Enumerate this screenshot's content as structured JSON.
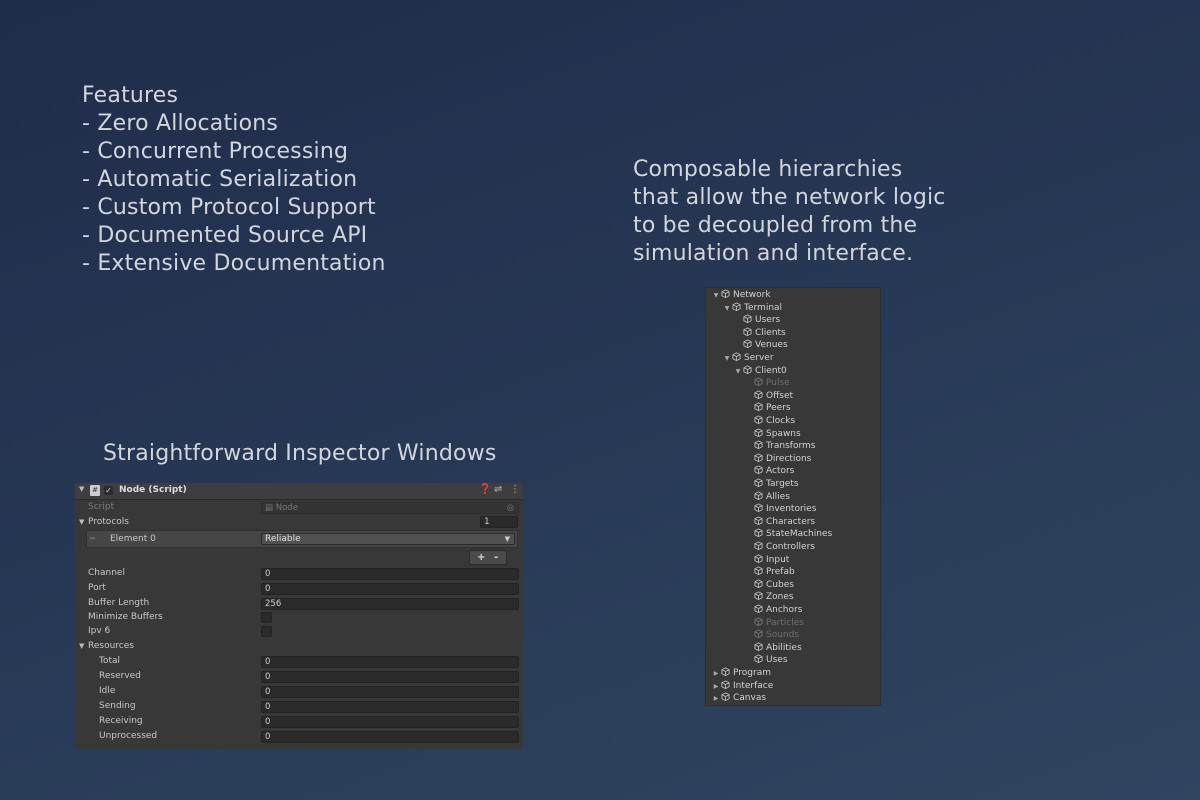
{
  "features": {
    "lines": [
      "Features",
      "- Zero Allocations",
      "- Concurrent Processing",
      "- Automatic Serialization",
      "- Custom Protocol Support",
      "- Documented Source API",
      "- Extensive Documentation"
    ]
  },
  "composable": {
    "lines": [
      "Composable hierarchies",
      "that allow the network logic",
      "to be decoupled from the",
      "simulation and interface."
    ]
  },
  "inspector_title": "Straightforward Inspector Windows",
  "inspector": {
    "header_title": "Node (Script)",
    "script_label": "Script",
    "script_value": "Node",
    "protocols_label": "Protocols",
    "protocols_count": "1",
    "element_label": "Element 0",
    "element_value": "Reliable",
    "plus": "+",
    "minus": "-",
    "channel_label": "Channel",
    "channel_value": "0",
    "port_label": "Port",
    "port_value": "0",
    "buffer_label": "Buffer Length",
    "buffer_value": "256",
    "minimize_label": "Minimize Buffers",
    "ipv6_label": "Ipv 6",
    "resources_label": "Resources",
    "total_label": "Total",
    "total_value": "0",
    "reserved_label": "Reserved",
    "reserved_value": "0",
    "idle_label": "Idle",
    "idle_value": "0",
    "sending_label": "Sending",
    "sending_value": "0",
    "receiving_label": "Receiving",
    "receiving_value": "0",
    "unprocessed_label": "Unprocessed",
    "unprocessed_value": "0"
  },
  "hierarchy": {
    "items": [
      {
        "label": "Network"
      },
      {
        "label": "Terminal"
      },
      {
        "label": "Users"
      },
      {
        "label": "Clients"
      },
      {
        "label": "Venues"
      },
      {
        "label": "Server"
      },
      {
        "label": "Client0"
      },
      {
        "label": "Pulse",
        "disabled": true
      },
      {
        "label": "Offset"
      },
      {
        "label": "Peers"
      },
      {
        "label": "Clocks"
      },
      {
        "label": "Spawns"
      },
      {
        "label": "Transforms"
      },
      {
        "label": "Directions"
      },
      {
        "label": "Actors"
      },
      {
        "label": "Targets"
      },
      {
        "label": "Allies"
      },
      {
        "label": "Inventories"
      },
      {
        "label": "Characters"
      },
      {
        "label": "StateMachines"
      },
      {
        "label": "Controllers"
      },
      {
        "label": "Input"
      },
      {
        "label": "Prefab"
      },
      {
        "label": "Cubes"
      },
      {
        "label": "Zones"
      },
      {
        "label": "Anchors"
      },
      {
        "label": "Particles",
        "disabled": true
      },
      {
        "label": "Sounds",
        "disabled": true
      },
      {
        "label": "Abilities"
      },
      {
        "label": "Uses"
      },
      {
        "label": "Program"
      },
      {
        "label": "Interface"
      },
      {
        "label": "Canvas"
      }
    ]
  }
}
